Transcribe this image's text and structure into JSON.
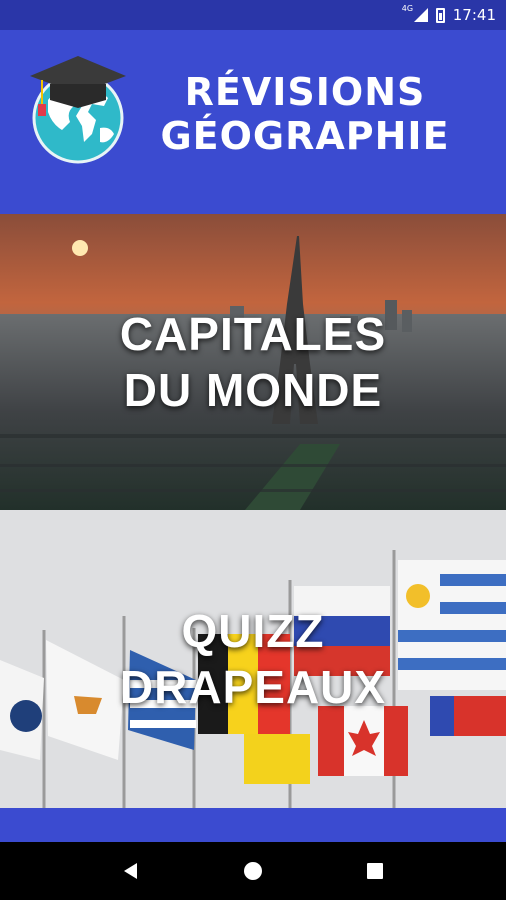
{
  "status_bar": {
    "network": "4G",
    "time": "17:41"
  },
  "header": {
    "title_line1": "RÉVISIONS",
    "title_line2": "GÉOGRAPHIE"
  },
  "menu": [
    {
      "label": "CAPITALES\nDU MONDE"
    },
    {
      "label": "QUIZZ\nDRAPEAUX"
    }
  ],
  "icons": {
    "logo": "graduation-globe-icon",
    "back": "back-icon",
    "home": "home-icon",
    "recents": "recents-icon"
  },
  "colors": {
    "primary": "#3b4bd0",
    "status_bar": "#2a36a8",
    "nav_bar": "#000000"
  }
}
